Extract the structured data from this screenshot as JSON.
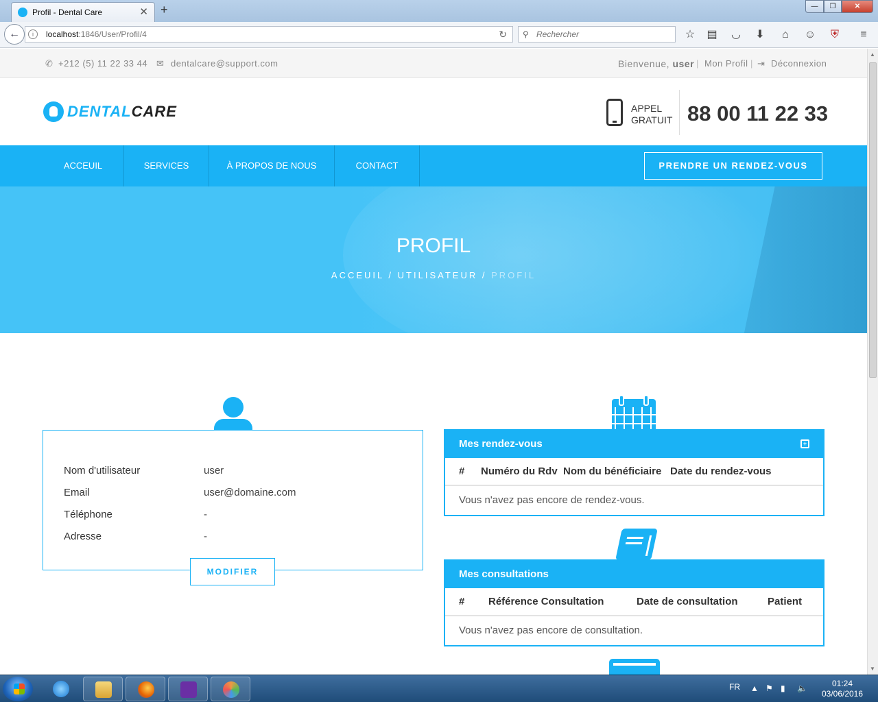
{
  "browser": {
    "tab_title": "Profil - Dental Care",
    "tab_close": "✕",
    "new_tab": "+",
    "url_host": "localhost",
    "url_rest": ":1846/User/Profil/4",
    "search_placeholder": "Rechercher",
    "window_controls": {
      "minimize": "—",
      "maximize": "❐",
      "close": "✕"
    },
    "toolbar_icons": [
      "star-icon",
      "reading-list-icon",
      "pocket-icon",
      "download-icon",
      "home-icon",
      "chat-icon",
      "ublock-icon",
      "menu-icon"
    ]
  },
  "topbar": {
    "phone": "+212 (5) 11 22 33 44",
    "email": "dentalcare@support.com",
    "welcome_prefix": "Bienvenue,",
    "welcome_user": "user",
    "separator": "|",
    "profile_link": "Mon Profil",
    "logout_link": "Déconnexion"
  },
  "header": {
    "logo_part1": "DENTAL",
    "logo_part2": "CARE",
    "appel_line1": "APPEL",
    "appel_line2": "GRATUIT",
    "big_phone": "88 00 11 22 33"
  },
  "nav": {
    "items": [
      "ACCEUIL",
      "SERVICES",
      "À PROPOS DE NOUS",
      "CONTACT"
    ],
    "cta": "PRENDRE UN RENDEZ-VOUS"
  },
  "hero": {
    "title": "PROFIL",
    "breadcrumb": [
      "ACCEUIL",
      "UTILISATEUR",
      "PROFIL"
    ],
    "separator": "/"
  },
  "profile": {
    "fields": [
      {
        "label": "Nom d'utilisateur",
        "value": "user"
      },
      {
        "label": "Email",
        "value": "user@domaine.com"
      },
      {
        "label": "Téléphone",
        "value": "-"
      },
      {
        "label": "Adresse",
        "value": "-"
      }
    ],
    "modify_button": "MODIFIER"
  },
  "rendezvous": {
    "title": "Mes rendez-vous",
    "columns": [
      "#",
      "Numéro du Rdv",
      "Nom du bénéficiaire",
      "Date du rendez-vous"
    ],
    "empty": "Vous n'avez pas encore de rendez-vous."
  },
  "consultations": {
    "title": "Mes consultations",
    "columns": [
      "#",
      "Référence Consultation",
      "Date de consultation",
      "Patient"
    ],
    "empty": "Vous n'avez pas encore de consultation."
  },
  "taskbar": {
    "apps": [
      "internet-explorer-icon",
      "file-explorer-icon",
      "firefox-icon",
      "visual-studio-icon",
      "paint-icon"
    ],
    "language": "FR",
    "time": "01:24",
    "date": "03/06/2016"
  },
  "colors": {
    "accent": "#1ab2f5",
    "hero": "#45c3f7"
  }
}
